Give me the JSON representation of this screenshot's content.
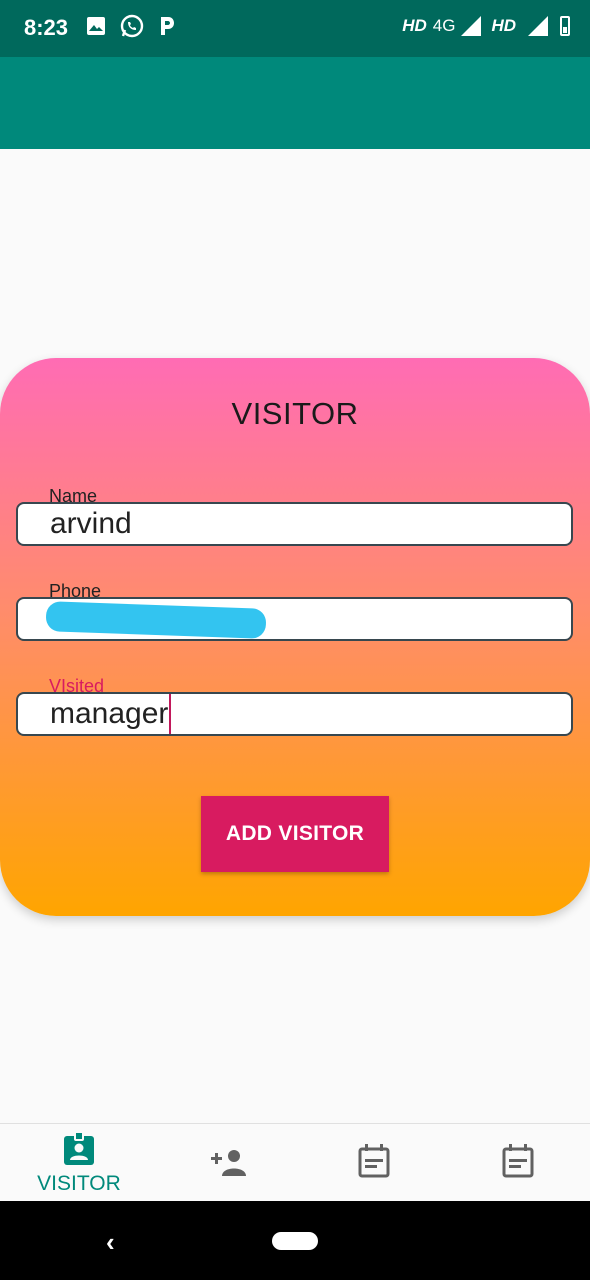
{
  "status_bar": {
    "time": "8:23",
    "network_1": "HD",
    "network_2": "4G",
    "network_3": "HD",
    "left_icons": [
      "image-icon",
      "whatsapp-icon",
      "paytm-icon"
    ]
  },
  "card": {
    "title": "VISITOR",
    "fields": {
      "name": {
        "label": "Name",
        "value": "arvind"
      },
      "phone": {
        "label": "Phone",
        "value": ""
      },
      "visited": {
        "label": "VIsited",
        "value": "manager"
      }
    },
    "add_button": "ADD VISITOR"
  },
  "bottom_nav": {
    "items": [
      {
        "label": "VISITOR",
        "icon": "badge-icon",
        "active": true
      },
      {
        "label": "",
        "icon": "add-person-icon",
        "active": false
      },
      {
        "label": "",
        "icon": "calendar-note-icon",
        "active": false
      },
      {
        "label": "",
        "icon": "calendar-note-icon",
        "active": false
      }
    ]
  },
  "colors": {
    "status_bar": "#00695c",
    "app_bar": "#00897b",
    "accent": "#d81b60",
    "gradient_top": "#ff6cb4",
    "gradient_bottom": "#ffa500"
  }
}
